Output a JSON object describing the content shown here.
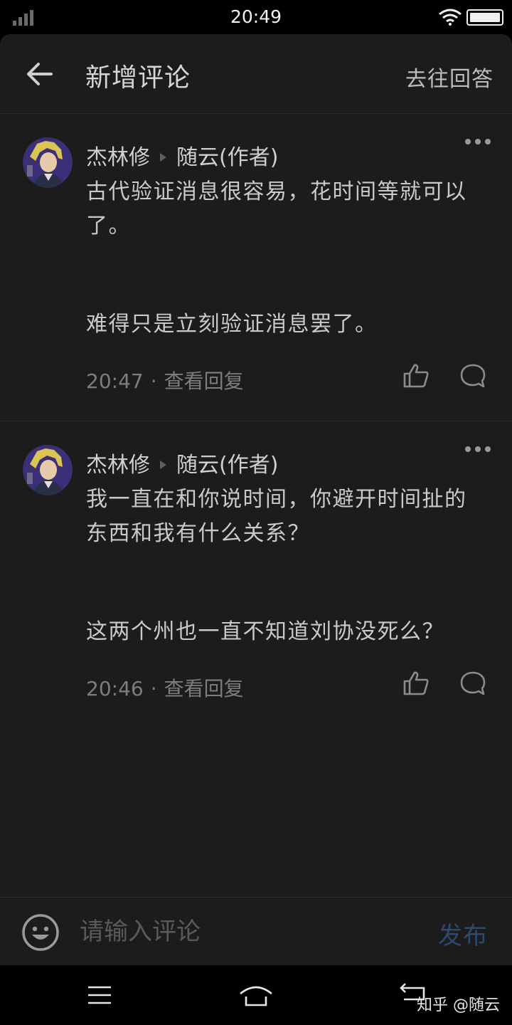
{
  "status_bar": {
    "time": "20:49"
  },
  "header": {
    "title": "新增评论",
    "action": "去往回答"
  },
  "comments": [
    {
      "author": "杰林修",
      "reply_to": "随云(作者)",
      "paragraphs": [
        "古代验证消息很容易，花时间等就可以了。",
        "难得只是立刻验证消息罢了。"
      ],
      "time": "20:47",
      "view_replies": "查看回复"
    },
    {
      "author": "杰林修",
      "reply_to": "随云(作者)",
      "paragraphs": [
        "我一直在和你说时间，你避开时间扯的东西和我有什么关系？",
        "这两个州也一直不知道刘协没死么？"
      ],
      "time": "20:46",
      "view_replies": "查看回复"
    }
  ],
  "composer": {
    "placeholder": "请输入评论",
    "value": "",
    "publish_label": "发布",
    "publish_color": "#2d4a6e"
  },
  "watermark": "知乎 @随云",
  "icons": [
    "signal-icon",
    "wifi-icon",
    "battery-icon",
    "back-arrow-icon",
    "more-icon",
    "thumbs-up-icon",
    "reply-bubble-icon",
    "emoji-icon",
    "menu-icon",
    "home-icon",
    "back-icon"
  ]
}
